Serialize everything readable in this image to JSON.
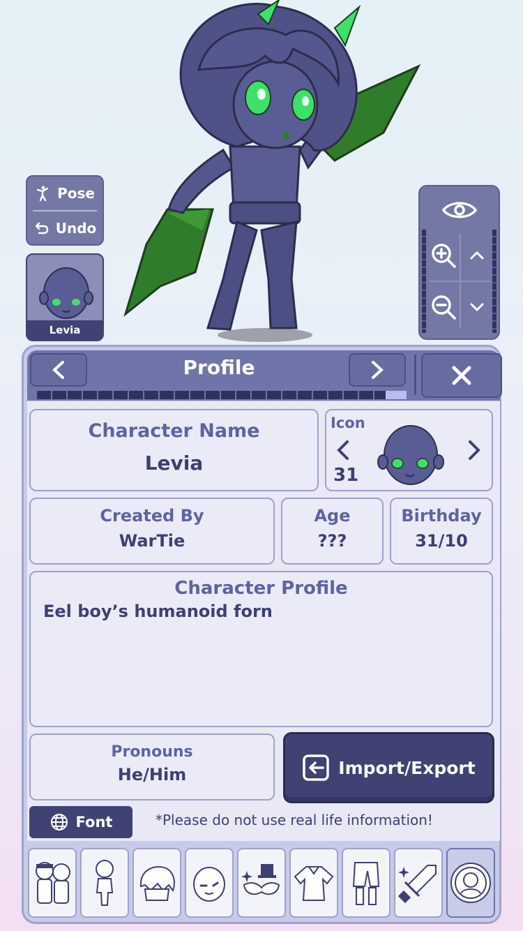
{
  "stage": {
    "pose_label": "Pose",
    "undo_label": "Undo",
    "thumb_name": "Levia",
    "icons": [
      "pose-icon",
      "undo-icon",
      "eye-icon",
      "zoom-in-icon",
      "zoom-out-icon",
      "chevron-up-icon",
      "chevron-down-icon"
    ]
  },
  "header": {
    "title": "Profile",
    "prev_glyph": "<",
    "next_glyph": ">",
    "close_glyph": "X",
    "progress_fraction": 0.95
  },
  "profile": {
    "name_label": "Character Name",
    "name_value": "Levia",
    "icon_label": "Icon",
    "icon_number": "31",
    "icon_prev": "<",
    "icon_next": ">",
    "created_label": "Created By",
    "created_value": "WarTie",
    "age_label": "Age",
    "age_value": "???",
    "birthday_label": "Birthday",
    "birthday_value": "31/10",
    "profile_label": "Character Profile",
    "profile_text": "Eel boy’s humanoid forn",
    "pronouns_label": "Pronouns",
    "pronouns_value": "He/Him"
  },
  "actions": {
    "import_export_label": "Import/Export",
    "font_label": "Font",
    "note": "*Please do not use real life information!"
  },
  "toolbar": {
    "tools": [
      "characters-tool",
      "body-tool",
      "hair-tool",
      "face-tool",
      "accessories-tool",
      "top-tool",
      "bottom-tool",
      "props-tool",
      "profile-tool"
    ],
    "active_index": 8
  },
  "colors": {
    "panel": "#c7cbe8",
    "header": "#7075a9",
    "dark": "#3f4273",
    "accent_green": "#3ee06a"
  }
}
